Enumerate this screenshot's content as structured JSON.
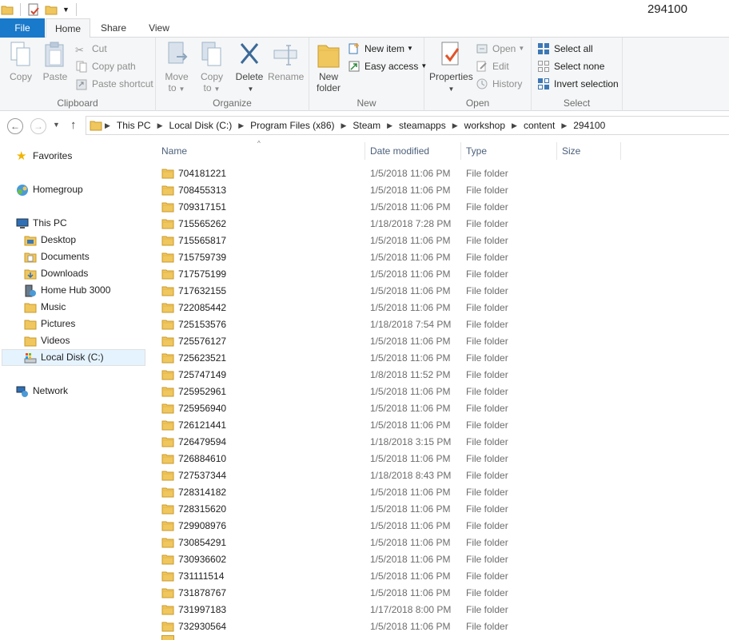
{
  "window": {
    "title": "294100"
  },
  "tabs": {
    "file": "File",
    "home": "Home",
    "share": "Share",
    "view": "View"
  },
  "ribbon": {
    "clipboard": {
      "label": "Clipboard",
      "copy": "Copy",
      "paste": "Paste",
      "cut": "Cut",
      "copy_path": "Copy path",
      "paste_shortcut": "Paste shortcut"
    },
    "organize": {
      "label": "Organize",
      "move_to_1": "Move",
      "move_to_2": "to",
      "copy_to_1": "Copy",
      "copy_to_2": "to",
      "delete": "Delete",
      "rename": "Rename"
    },
    "new": {
      "label": "New",
      "new_folder_1": "New",
      "new_folder_2": "folder",
      "new_item": "New item",
      "easy_access": "Easy access"
    },
    "open": {
      "label": "Open",
      "properties": "Properties",
      "open": "Open",
      "edit": "Edit",
      "history": "History"
    },
    "select": {
      "label": "Select",
      "select_all": "Select all",
      "select_none": "Select none",
      "invert_selection": "Invert selection"
    }
  },
  "address": {
    "crumbs": [
      "This PC",
      "Local Disk (C:)",
      "Program Files (x86)",
      "Steam",
      "steamapps",
      "workshop",
      "content",
      "294100"
    ]
  },
  "navpane": {
    "favorites": "Favorites",
    "homegroup": "Homegroup",
    "this_pc": "This PC",
    "desktop": "Desktop",
    "documents": "Documents",
    "downloads": "Downloads",
    "home_hub": "Home Hub 3000",
    "music": "Music",
    "pictures": "Pictures",
    "videos": "Videos",
    "local_disk": "Local Disk (C:)",
    "network": "Network"
  },
  "columns": {
    "name": "Name",
    "date": "Date modified",
    "type": "Type",
    "size": "Size"
  },
  "files": [
    {
      "name": "704181221",
      "date": "1/5/2018 11:06 PM",
      "type": "File folder"
    },
    {
      "name": "708455313",
      "date": "1/5/2018 11:06 PM",
      "type": "File folder"
    },
    {
      "name": "709317151",
      "date": "1/5/2018 11:06 PM",
      "type": "File folder"
    },
    {
      "name": "715565262",
      "date": "1/18/2018 7:28 PM",
      "type": "File folder"
    },
    {
      "name": "715565817",
      "date": "1/5/2018 11:06 PM",
      "type": "File folder"
    },
    {
      "name": "715759739",
      "date": "1/5/2018 11:06 PM",
      "type": "File folder"
    },
    {
      "name": "717575199",
      "date": "1/5/2018 11:06 PM",
      "type": "File folder"
    },
    {
      "name": "717632155",
      "date": "1/5/2018 11:06 PM",
      "type": "File folder"
    },
    {
      "name": "722085442",
      "date": "1/5/2018 11:06 PM",
      "type": "File folder"
    },
    {
      "name": "725153576",
      "date": "1/18/2018 7:54 PM",
      "type": "File folder"
    },
    {
      "name": "725576127",
      "date": "1/5/2018 11:06 PM",
      "type": "File folder"
    },
    {
      "name": "725623521",
      "date": "1/5/2018 11:06 PM",
      "type": "File folder"
    },
    {
      "name": "725747149",
      "date": "1/8/2018 11:52 PM",
      "type": "File folder"
    },
    {
      "name": "725952961",
      "date": "1/5/2018 11:06 PM",
      "type": "File folder"
    },
    {
      "name": "725956940",
      "date": "1/5/2018 11:06 PM",
      "type": "File folder"
    },
    {
      "name": "726121441",
      "date": "1/5/2018 11:06 PM",
      "type": "File folder"
    },
    {
      "name": "726479594",
      "date": "1/18/2018 3:15 PM",
      "type": "File folder"
    },
    {
      "name": "726884610",
      "date": "1/5/2018 11:06 PM",
      "type": "File folder"
    },
    {
      "name": "727537344",
      "date": "1/18/2018 8:43 PM",
      "type": "File folder"
    },
    {
      "name": "728314182",
      "date": "1/5/2018 11:06 PM",
      "type": "File folder"
    },
    {
      "name": "728315620",
      "date": "1/5/2018 11:06 PM",
      "type": "File folder"
    },
    {
      "name": "729908976",
      "date": "1/5/2018 11:06 PM",
      "type": "File folder"
    },
    {
      "name": "730854291",
      "date": "1/5/2018 11:06 PM",
      "type": "File folder"
    },
    {
      "name": "730936602",
      "date": "1/5/2018 11:06 PM",
      "type": "File folder"
    },
    {
      "name": "731111514",
      "date": "1/5/2018 11:06 PM",
      "type": "File folder"
    },
    {
      "name": "731878767",
      "date": "1/5/2018 11:06 PM",
      "type": "File folder"
    },
    {
      "name": "731997183",
      "date": "1/17/2018 8:00 PM",
      "type": "File folder"
    },
    {
      "name": "732930564",
      "date": "1/5/2018 11:06 PM",
      "type": "File folder"
    }
  ],
  "colors": {
    "file_tab": "#1979ca",
    "folder": "#f0c75e",
    "selected": "#e5f3ff"
  }
}
